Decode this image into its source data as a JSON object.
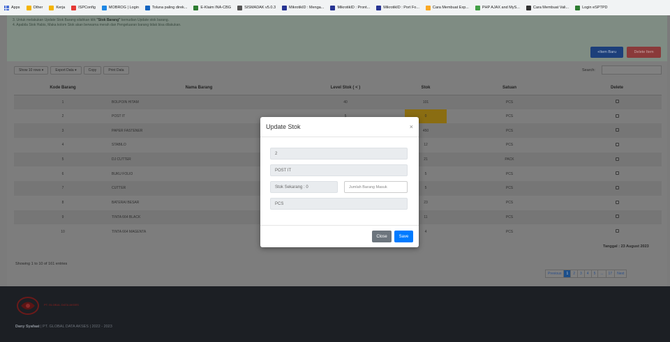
{
  "bookmarks": [
    {
      "label": "Apps",
      "color": "#4a6fd6"
    },
    {
      "label": "Other",
      "color": "#f4b400"
    },
    {
      "label": "Kerja",
      "color": "#f4b400"
    },
    {
      "label": "ISPConfig",
      "color": "#e53935"
    },
    {
      "label": "MOBROG | Login",
      "color": "#1e88e5"
    },
    {
      "label": "Toluna paling direk...",
      "color": "#1565c0"
    },
    {
      "label": "E-Klaim INA-CBG",
      "color": "#2e7d32"
    },
    {
      "label": "SISMADAK v5.0.3",
      "color": "#555555"
    },
    {
      "label": "MikrotikID : Menga...",
      "color": "#283593"
    },
    {
      "label": "MikrotikID : Pront...",
      "color": "#283593"
    },
    {
      "label": "MikrotikID : Port Fo...",
      "color": "#283593"
    },
    {
      "label": "Cara Membuat Exp...",
      "color": "#f9a825"
    },
    {
      "label": "PHP AJAX and MyS...",
      "color": "#43a047"
    },
    {
      "label": "Cara Membuat Vali...",
      "color": "#333333"
    },
    {
      "label": "Login eSPTPD",
      "color": "#2e7d32"
    }
  ],
  "notice": {
    "line3_pre": "3. Untuk melakukan Update Stok Barang silahkan klik ",
    "line3_bold": "\"Stok Barang\"",
    "line3_post": " kemudian Update stok barang.",
    "line4": "4. Apabila Stok Habis, Maka kolom Stok akan berwarna merah dan Pengeluaran barang tidak bisa dilakukan."
  },
  "actions": {
    "new_item": "+Item Baru",
    "delete_item": "Delete Item"
  },
  "toolbar": {
    "show_rows": "Show 10 rows",
    "export": "Export Data",
    "copy": "Copy",
    "print": "Print Data"
  },
  "search": {
    "label": "Search:"
  },
  "table": {
    "headers": [
      "Kode Barang",
      "Nama Barang",
      "Level Stok ( < )",
      "Stok",
      "Satuan",
      "Delete"
    ],
    "rows": [
      {
        "kode": "1",
        "nama": "BOLPOIN HITAM",
        "level": "40",
        "stok": "101",
        "satuan": "PCS"
      },
      {
        "kode": "2",
        "nama": "POST IT",
        "level": "5",
        "stok": "0",
        "satuan": "PCS"
      },
      {
        "kode": "3",
        "nama": "PAPER FASTENER",
        "level": "",
        "stok": "450",
        "satuan": "PCS"
      },
      {
        "kode": "4",
        "nama": "STABILO",
        "level": "",
        "stok": "12",
        "satuan": "PCS"
      },
      {
        "kode": "5",
        "nama": "DJ CUTTER",
        "level": "",
        "stok": "21",
        "satuan": "PACK"
      },
      {
        "kode": "6",
        "nama": "BUKU FOLIO",
        "level": "",
        "stok": "5",
        "satuan": "PCS"
      },
      {
        "kode": "7",
        "nama": "CUTTER",
        "level": "",
        "stok": "5",
        "satuan": "PCS"
      },
      {
        "kode": "8",
        "nama": "BATERAI BESAR",
        "level": "",
        "stok": "23",
        "satuan": "PCS"
      },
      {
        "kode": "9",
        "nama": "TINTA 664 BLACK",
        "level": "",
        "stok": "11",
        "satuan": "PCS"
      },
      {
        "kode": "10",
        "nama": "TINTA 664 MAGENTA",
        "level": "",
        "stok": "4",
        "satuan": "PCS"
      }
    ]
  },
  "tanggal": "Tanggal : 23 August 2023",
  "showing": "Showing 1 to 10 of 161 entries",
  "pagination": [
    "Previous",
    "1",
    "2",
    "3",
    "4",
    "5",
    "...",
    "17",
    "Next"
  ],
  "footer": {
    "logo_text": "PT. GLOBAL DATA AKSES",
    "author": "Dany Syafaat",
    "rest": " | PT. GLOBAL DATA AKSES | 2022 - 2023"
  },
  "modal": {
    "title": "Update Stok",
    "close_symbol": "×",
    "kode": "2",
    "nama": "POST IT",
    "stok_sekarang": "Stok Sekarang : 0",
    "jumlah_placeholder": "Jumlah Barang Masuk",
    "satuan": "PCS",
    "close_label": "Close",
    "save_label": "Save"
  },
  "colors": {
    "highlight_row": "#f0ad00",
    "primary": "#007bff",
    "secondary": "#6c757d"
  }
}
